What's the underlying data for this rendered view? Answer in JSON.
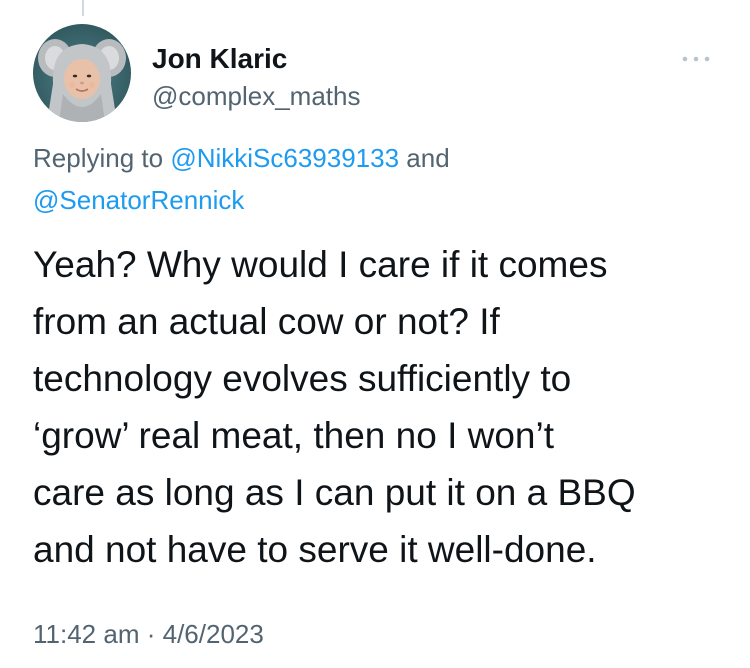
{
  "tweet": {
    "author": {
      "name": "Jon Klaric",
      "handle": "@complex_maths",
      "avatar_icon": "avatar-baby-elephant-hood"
    },
    "more_icon": "more-horizontal-icon",
    "reply": {
      "prefix": "Replying to",
      "mention_1": "@NikkiSc63939133",
      "joiner": "and",
      "mention_2": "@SenatorRennick"
    },
    "text_lines": [
      "Yeah? Why would I care if it comes",
      "from an actual cow or not? If",
      "technology evolves sufficiently to",
      "‘grow’ real meat, then no I won’t",
      "care as long as I can put it on a BBQ",
      "and not have to serve it well-done."
    ],
    "time": "11:42 am",
    "separator": "·",
    "date": "4/6/2023"
  },
  "colors": {
    "text_primary": "#0f1419",
    "text_secondary": "#536471",
    "link": "#1d9bf0",
    "thread_line": "#cfd9de"
  }
}
